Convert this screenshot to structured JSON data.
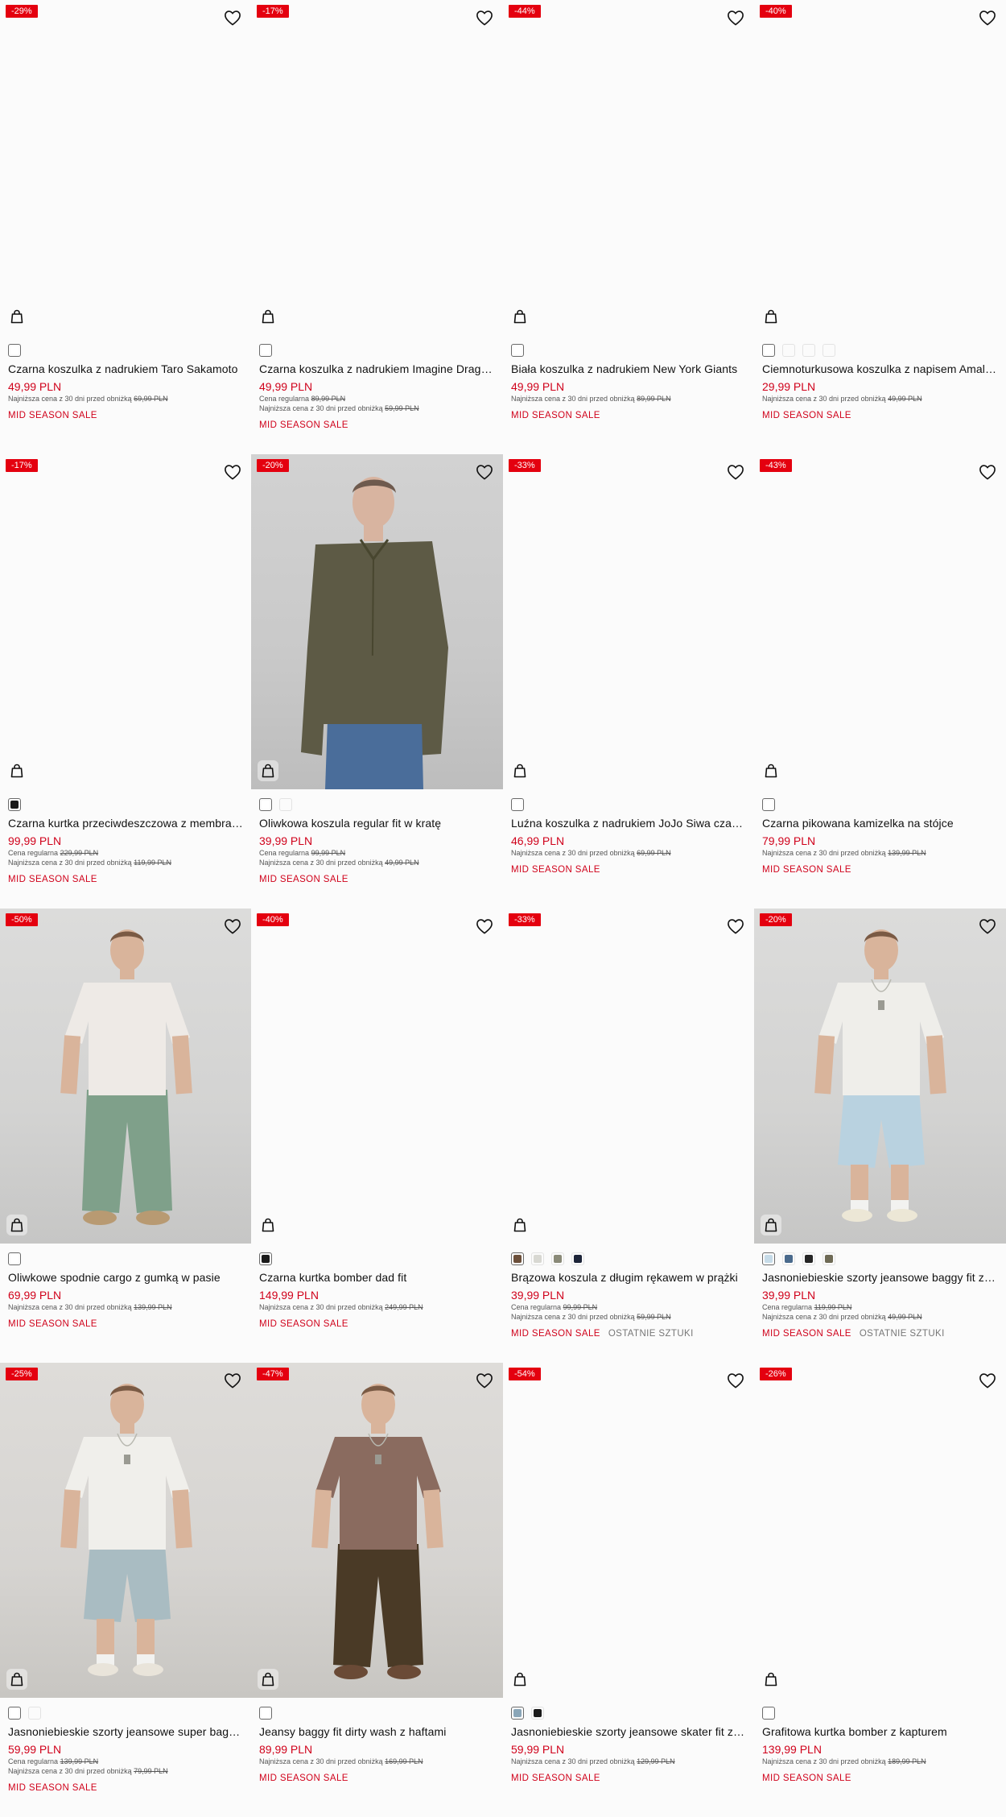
{
  "products": [
    {
      "badge": "-29%",
      "name": "Czarna koszulka z nadrukiem Taro Sakamoto",
      "price": "49,99 PLN",
      "regular_label": "",
      "regular_price": "",
      "lowest_label": "Najniższa cena z 30 dni przed obniżką",
      "lowest_price": "69,99 PLN",
      "tags": [
        "MID SEASON SALE"
      ],
      "swatches": [
        "#ffffff"
      ],
      "selected": 0,
      "photo": "blank"
    },
    {
      "badge": "-17%",
      "name": "Czarna koszulka z nadrukiem Imagine Dragons",
      "price": "49,99 PLN",
      "regular_label": "Cena regularna",
      "regular_price": "89,99 PLN",
      "lowest_label": "Najniższa cena z 30 dni przed obniżką",
      "lowest_price": "59,99 PLN",
      "tags": [
        "MID SEASON SALE"
      ],
      "swatches": [
        "#ffffff"
      ],
      "selected": 0,
      "photo": "blank"
    },
    {
      "badge": "-44%",
      "name": "Biała koszulka z nadrukiem New York Giants",
      "price": "49,99 PLN",
      "regular_label": "",
      "regular_price": "",
      "lowest_label": "Najniższa cena z 30 dni przed obniżką",
      "lowest_price": "89,99 PLN",
      "tags": [
        "MID SEASON SALE"
      ],
      "swatches": [
        "#ffffff"
      ],
      "selected": 0,
      "photo": "blank"
    },
    {
      "badge": "-40%",
      "name": "Ciemnoturkusowa koszulka z napisem Amalfi Coast",
      "price": "29,99 PLN",
      "regular_label": "",
      "regular_price": "",
      "lowest_label": "Najniższa cena z 30 dni przed obniżką",
      "lowest_price": "49,99 PLN",
      "tags": [
        "MID SEASON SALE"
      ],
      "swatches": [
        "#ffffff",
        "#fbfbfb",
        "#fbfbfb",
        "#fbfbfb"
      ],
      "selected": 0,
      "photo": "blank"
    },
    {
      "badge": "-17%",
      "name": "Czarna kurtka przeciwdeszczowa z membraną",
      "price": "99,99 PLN",
      "regular_label": "Cena regularna",
      "regular_price": "229,99 PLN",
      "lowest_label": "Najniższa cena z 30 dni przed obniżką",
      "lowest_price": "119,99 PLN",
      "tags": [
        "MID SEASON SALE"
      ],
      "swatches": [
        "#1a1a1a"
      ],
      "selected": 0,
      "photo": "blank"
    },
    {
      "badge": "-20%",
      "name": "Oliwkowa koszula regular fit w kratę",
      "price": "39,99 PLN",
      "regular_label": "Cena regularna",
      "regular_price": "99,99 PLN",
      "lowest_label": "Najniższa cena z 30 dni przed obniżką",
      "lowest_price": "49,99 PLN",
      "tags": [
        "MID SEASON SALE"
      ],
      "swatches": [
        "#ffffff",
        "#fbfbfb"
      ],
      "selected": 0,
      "photo": "shirt"
    },
    {
      "badge": "-33%",
      "name": "Luźna koszulka z nadrukiem JoJo Siwa czarna",
      "price": "46,99 PLN",
      "regular_label": "",
      "regular_price": "",
      "lowest_label": "Najniższa cena z 30 dni przed obniżką",
      "lowest_price": "69,99 PLN",
      "tags": [
        "MID SEASON SALE"
      ],
      "swatches": [
        "#ffffff"
      ],
      "selected": 0,
      "photo": "blank"
    },
    {
      "badge": "-43%",
      "name": "Czarna pikowana kamizelka na stójce",
      "price": "79,99 PLN",
      "regular_label": "",
      "regular_price": "",
      "lowest_label": "Najniższa cena z 30 dni przed obniżką",
      "lowest_price": "139,99 PLN",
      "tags": [
        "MID SEASON SALE"
      ],
      "swatches": [
        "#ffffff"
      ],
      "selected": 0,
      "photo": "blank"
    },
    {
      "badge": "-50%",
      "name": "Oliwkowe spodnie cargo z gumką w pasie",
      "price": "69,99 PLN",
      "regular_label": "",
      "regular_price": "",
      "lowest_label": "Najniższa cena z 30 dni przed obniżką",
      "lowest_price": "139,99 PLN",
      "tags": [
        "MID SEASON SALE"
      ],
      "swatches": [
        "#ffffff"
      ],
      "selected": 0,
      "photo": "cargo"
    },
    {
      "badge": "-40%",
      "name": "Czarna kurtka bomber dad fit",
      "price": "149,99 PLN",
      "regular_label": "",
      "regular_price": "",
      "lowest_label": "Najniższa cena z 30 dni przed obniżką",
      "lowest_price": "249,99 PLN",
      "tags": [
        "MID SEASON SALE"
      ],
      "swatches": [
        "#1a1a1a"
      ],
      "selected": 0,
      "photo": "blank"
    },
    {
      "badge": "-33%",
      "name": "Brązowa koszula z długim rękawem w prążki",
      "price": "39,99 PLN",
      "regular_label": "Cena regularna",
      "regular_price": "99,99 PLN",
      "lowest_label": "Najniższa cena z 30 dni przed obniżką",
      "lowest_price": "59,99 PLN",
      "tags": [
        "MID SEASON SALE",
        "OSTATNIE SZTUKI"
      ],
      "swatches": [
        "#6b4f3a",
        "#d8d8d2",
        "#8a8a78",
        "#1c2438"
      ],
      "selected": 0,
      "photo": "blank"
    },
    {
      "badge": "-20%",
      "name": "Jasnoniebieskie szorty jeansowe baggy fit z przetarciami",
      "price": "39,99 PLN",
      "regular_label": "Cena regularna",
      "regular_price": "119,99 PLN",
      "lowest_label": "Najniższa cena z 30 dni przed obniżką",
      "lowest_price": "49,99 PLN",
      "tags": [
        "MID SEASON SALE",
        "OSTATNIE SZTUKI"
      ],
      "swatches": [
        "#c6dbe8",
        "#4a6a8c",
        "#252525",
        "#6e6a55"
      ],
      "selected": 0,
      "photo": "shorts1"
    },
    {
      "badge": "-25%",
      "name": "Jasnoniebieskie szorty jeansowe super baggy fit",
      "price": "59,99 PLN",
      "regular_label": "Cena regularna",
      "regular_price": "139,99 PLN",
      "lowest_label": "Najniższa cena z 30 dni przed obniżką",
      "lowest_price": "79,99 PLN",
      "tags": [
        "MID SEASON SALE"
      ],
      "swatches": [
        "#ffffff",
        "#fbfbfb"
      ],
      "selected": 0,
      "photo": "shorts2"
    },
    {
      "badge": "-47%",
      "name": "Jeansy baggy fit dirty wash z haftami",
      "price": "89,99 PLN",
      "regular_label": "",
      "regular_price": "",
      "lowest_label": "Najniższa cena z 30 dni przed obniżką",
      "lowest_price": "169,99 PLN",
      "tags": [
        "MID SEASON SALE"
      ],
      "swatches": [
        "#ffffff"
      ],
      "selected": 0,
      "photo": "jeans"
    },
    {
      "badge": "-54%",
      "name": "Jasnoniebieskie szorty jeansowe skater fit z przetarciami",
      "price": "59,99 PLN",
      "regular_label": "",
      "regular_price": "",
      "lowest_label": "Najniższa cena z 30 dni przed obniżką",
      "lowest_price": "129,99 PLN",
      "tags": [
        "MID SEASON SALE"
      ],
      "swatches": [
        "#8aa6b8",
        "#1a1a1a"
      ],
      "selected": 0,
      "photo": "blank"
    },
    {
      "badge": "-26%",
      "name": "Grafitowa kurtka bomber z kapturem",
      "price": "139,99 PLN",
      "regular_label": "",
      "regular_price": "",
      "lowest_label": "Najniższa cena z 30 dni przed obniżką",
      "lowest_price": "189,99 PLN",
      "tags": [
        "MID SEASON SALE"
      ],
      "swatches": [
        "#ffffff"
      ],
      "selected": 0,
      "photo": "blank"
    }
  ],
  "icons": {
    "favorite": "heart-icon",
    "add_to_cart": "shopping-bag-icon"
  },
  "colors": {
    "discount_badge": "#e4000f",
    "sale_price": "#d0021b",
    "tag_last_pieces": "#777777"
  }
}
